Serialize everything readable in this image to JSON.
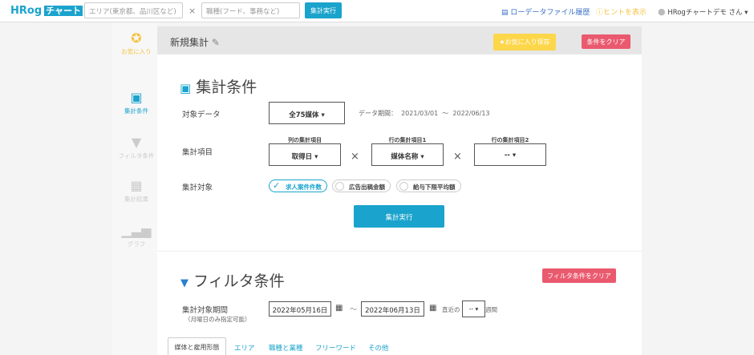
{
  "header": {
    "logo_text": "HRog",
    "logo_badge": "チャート",
    "area_placeholder": "エリア(東京都、品川区など)",
    "times": "×",
    "job_placeholder": "職種(フード、事務など)",
    "search_button": "集計実行",
    "history_link": "ローデータファイル履歴",
    "hint_link": "ヒントを表示",
    "user_name": "HRogチャートデモ さん"
  },
  "sidebar": {
    "items": [
      {
        "label": "お気に入り"
      },
      {
        "label": "集計条件"
      },
      {
        "label": "フィルタ条件"
      },
      {
        "label": "集計結果"
      },
      {
        "label": "グラフ"
      }
    ]
  },
  "page": {
    "title": "新規集計",
    "favorite_button": "★お気に入り保存",
    "clear_button": "条件をクリア"
  },
  "conditions": {
    "title": "集計条件",
    "target_data_label": "対象データ",
    "target_data_value": "全75媒体",
    "period_label": "データ期間：",
    "period_start": "2021/03/01",
    "period_sep": "〜",
    "period_end": "2022/06/13",
    "items_label": "集計項目",
    "col_label": "列の集計項目",
    "col_value": "取得日",
    "row1_label": "行の集計項目1",
    "row1_value": "媒体名称",
    "row2_label": "行の集計項目2",
    "row2_value": "--",
    "times": "×",
    "target_label": "集計対象",
    "targets": [
      {
        "label": "求人案件件数",
        "checked": true
      },
      {
        "label": "広告出稿金額",
        "checked": false
      },
      {
        "label": "給与下限平均額",
        "checked": false
      }
    ],
    "run_button": "集計実行"
  },
  "filter": {
    "title": "フィルタ条件",
    "clear_button": "フィルタ条件をクリア",
    "period_label": "集計対象期間",
    "period_note": "（月曜日のみ指定可能）",
    "date_from": "2022年05月16日",
    "sep": "〜",
    "date_to": "2022年06月13日",
    "recent_prefix": "直近の",
    "recent_value": "--",
    "recent_suffix": "週間",
    "tabs": [
      {
        "label": "媒体と雇用形態"
      },
      {
        "label": "エリア"
      },
      {
        "label": "職種と業種"
      },
      {
        "label": "フリーワード"
      },
      {
        "label": "その他"
      }
    ]
  },
  "colors": {
    "accent": "#1aa3cc",
    "favorite": "#fdd64a",
    "clear": "#ea5a6f"
  }
}
